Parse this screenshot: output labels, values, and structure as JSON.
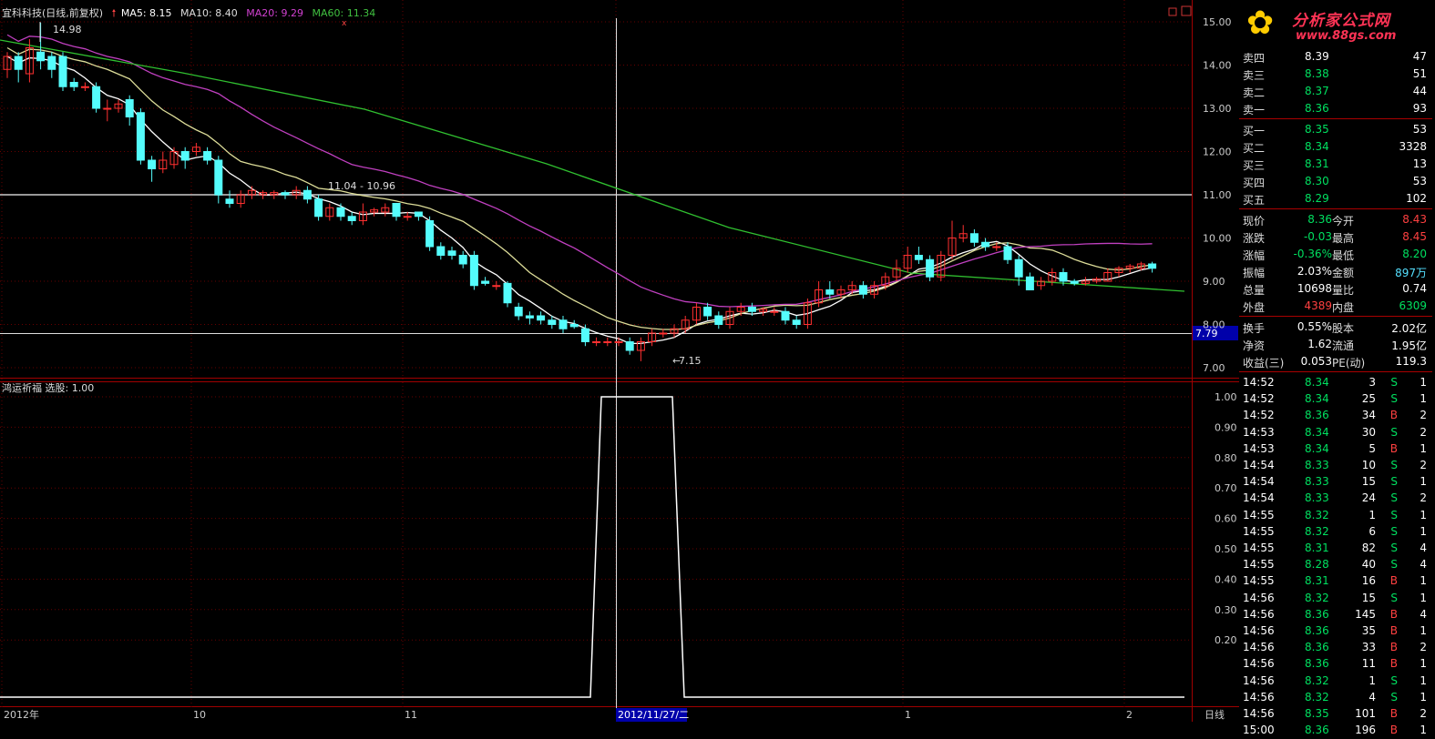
{
  "stock": {
    "name": "宜科科技(日线,前复权)",
    "ma5": "MA5: 8.15",
    "ma10": "MA10: 8.40",
    "ma20": "MA20: 9.29",
    "ma60": "MA60: 11.34"
  },
  "indicator": {
    "label": "鸿运祈福 选股: 1.00"
  },
  "annotations": {
    "high": "14.98",
    "low": "7.15",
    "range": "11.04 - 10.96",
    "current_line": "7.79"
  },
  "price_axis": [
    "15.00",
    "14.00",
    "13.00",
    "12.00",
    "11.00",
    "10.00",
    "9.00",
    "8.00",
    "7.00"
  ],
  "ind_axis": [
    "1.00",
    "0.90",
    "0.80",
    "0.70",
    "0.60",
    "0.50",
    "0.40",
    "0.30",
    "0.20"
  ],
  "date_axis": [
    "2012年",
    "10",
    "11",
    "2012/11/27/二",
    "1",
    "2"
  ],
  "period_label": "日线",
  "logo": {
    "title": "分析家公式网",
    "url": "www.88gs.com"
  },
  "ask": [
    {
      "label": "卖四",
      "price": "8.39",
      "vol": "47"
    },
    {
      "label": "卖三",
      "price": "8.38",
      "vol": "51"
    },
    {
      "label": "卖二",
      "price": "8.37",
      "vol": "44"
    },
    {
      "label": "卖一",
      "price": "8.36",
      "vol": "93"
    }
  ],
  "bid": [
    {
      "label": "买一",
      "price": "8.35",
      "vol": "53"
    },
    {
      "label": "买二",
      "price": "8.34",
      "vol": "3328"
    },
    {
      "label": "买三",
      "price": "8.31",
      "vol": "13"
    },
    {
      "label": "买四",
      "price": "8.30",
      "vol": "53"
    },
    {
      "label": "买五",
      "price": "8.29",
      "vol": "102"
    }
  ],
  "quote": [
    {
      "l1": "现价",
      "v1": "8.36",
      "l2": "今开",
      "v2": "8.43"
    },
    {
      "l1": "涨跌",
      "v1": "-0.03",
      "l2": "最高",
      "v2": "8.45"
    },
    {
      "l1": "涨幅",
      "v1": "-0.36%",
      "l2": "最低",
      "v2": "8.20"
    },
    {
      "l1": "振幅",
      "v1": "2.03%",
      "l2": "金额",
      "v2": "897万"
    },
    {
      "l1": "总量",
      "v1": "10698",
      "l2": "量比",
      "v2": "0.74"
    },
    {
      "l1": "外盘",
      "v1": "4389",
      "l2": "内盘",
      "v2": "6309"
    }
  ],
  "fund": [
    {
      "l1": "换手",
      "v1": "0.55%",
      "l2": "股本",
      "v2": "2.02亿"
    },
    {
      "l1": "净资",
      "v1": "1.62",
      "l2": "流通",
      "v2": "1.95亿"
    },
    {
      "l1": "收益(三)",
      "v1": "0.053",
      "l2": "PE(动)",
      "v2": "119.3"
    }
  ],
  "ticks": [
    {
      "t": "14:52",
      "p": "8.34",
      "v": "3",
      "s": "S",
      "n": "1"
    },
    {
      "t": "14:52",
      "p": "8.34",
      "v": "25",
      "s": "S",
      "n": "1"
    },
    {
      "t": "14:52",
      "p": "8.36",
      "v": "34",
      "s": "B",
      "n": "2"
    },
    {
      "t": "14:53",
      "p": "8.34",
      "v": "30",
      "s": "S",
      "n": "2"
    },
    {
      "t": "14:53",
      "p": "8.34",
      "v": "5",
      "s": "B",
      "n": "1"
    },
    {
      "t": "14:54",
      "p": "8.33",
      "v": "10",
      "s": "S",
      "n": "2"
    },
    {
      "t": "14:54",
      "p": "8.33",
      "v": "15",
      "s": "S",
      "n": "1"
    },
    {
      "t": "14:54",
      "p": "8.33",
      "v": "24",
      "s": "S",
      "n": "2"
    },
    {
      "t": "14:55",
      "p": "8.32",
      "v": "1",
      "s": "S",
      "n": "1"
    },
    {
      "t": "14:55",
      "p": "8.32",
      "v": "6",
      "s": "S",
      "n": "1"
    },
    {
      "t": "14:55",
      "p": "8.31",
      "v": "82",
      "s": "S",
      "n": "4"
    },
    {
      "t": "14:55",
      "p": "8.28",
      "v": "40",
      "s": "S",
      "n": "4"
    },
    {
      "t": "14:55",
      "p": "8.31",
      "v": "16",
      "s": "B",
      "n": "1"
    },
    {
      "t": "14:56",
      "p": "8.32",
      "v": "15",
      "s": "S",
      "n": "1"
    },
    {
      "t": "14:56",
      "p": "8.36",
      "v": "145",
      "s": "B",
      "n": "4"
    },
    {
      "t": "14:56",
      "p": "8.36",
      "v": "35",
      "s": "B",
      "n": "1"
    },
    {
      "t": "14:56",
      "p": "8.36",
      "v": "33",
      "s": "B",
      "n": "2"
    },
    {
      "t": "14:56",
      "p": "8.36",
      "v": "11",
      "s": "B",
      "n": "1"
    },
    {
      "t": "14:56",
      "p": "8.32",
      "v": "1",
      "s": "S",
      "n": "1"
    },
    {
      "t": "14:56",
      "p": "8.32",
      "v": "4",
      "s": "S",
      "n": "1"
    },
    {
      "t": "14:56",
      "p": "8.35",
      "v": "101",
      "s": "B",
      "n": "2"
    },
    {
      "t": "15:00",
      "p": "8.36",
      "v": "196",
      "s": "B",
      "n": "1"
    }
  ]
}
